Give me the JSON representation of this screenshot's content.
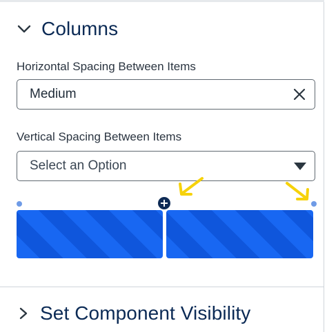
{
  "columns_section": {
    "title": "Columns",
    "horizontal_spacing": {
      "label": "Horizontal Spacing Between Items",
      "value": "Medium"
    },
    "vertical_spacing": {
      "label": "Vertical Spacing Between Items",
      "placeholder": "Select an Option"
    }
  },
  "visibility_section": {
    "title": "Set Component Visibility"
  },
  "colors": {
    "title_navy": "#0b2a55",
    "column_blue": "#1867f2",
    "column_stripe": "#0f56dc",
    "annotation_yellow": "#f6d20a",
    "handle_dot": "#6f9be6"
  },
  "icons": {
    "collapse": "chevron-down-icon",
    "expand": "chevron-right-icon",
    "clear": "close-icon",
    "dropdown": "caret-down-icon",
    "add": "plus-circle-icon"
  }
}
